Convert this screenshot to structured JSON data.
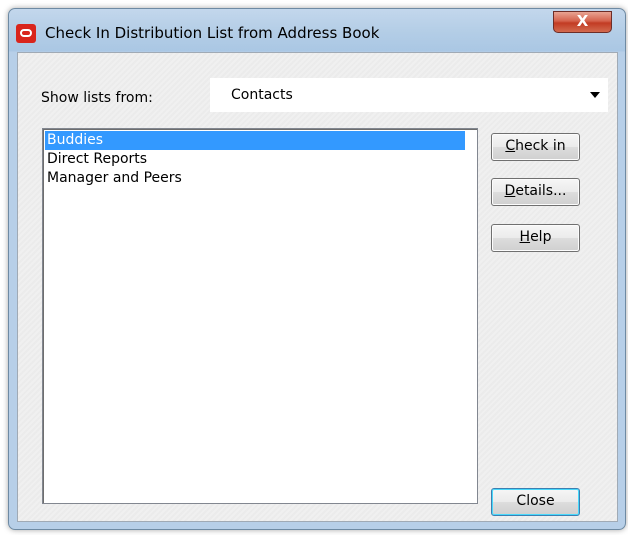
{
  "window": {
    "title": "Check In Distribution List from Address Book",
    "close_glyph": "X",
    "app_icon": "oracle-logo-icon"
  },
  "show_lists": {
    "label": "Show lists from:",
    "value": "Contacts"
  },
  "list": {
    "items": [
      {
        "label": "Buddies",
        "selected": true
      },
      {
        "label": "Direct Reports",
        "selected": false
      },
      {
        "label": "Manager and Peers",
        "selected": false
      }
    ]
  },
  "buttons": {
    "check_in": {
      "mnemonic": "C",
      "rest": "heck in"
    },
    "details": {
      "mnemonic": "D",
      "rest": "etails..."
    },
    "help": {
      "mnemonic": "H",
      "rest": "elp"
    },
    "close": "Close"
  },
  "colors": {
    "selection": "#3399ff",
    "title_close_button": "#c23b23"
  }
}
